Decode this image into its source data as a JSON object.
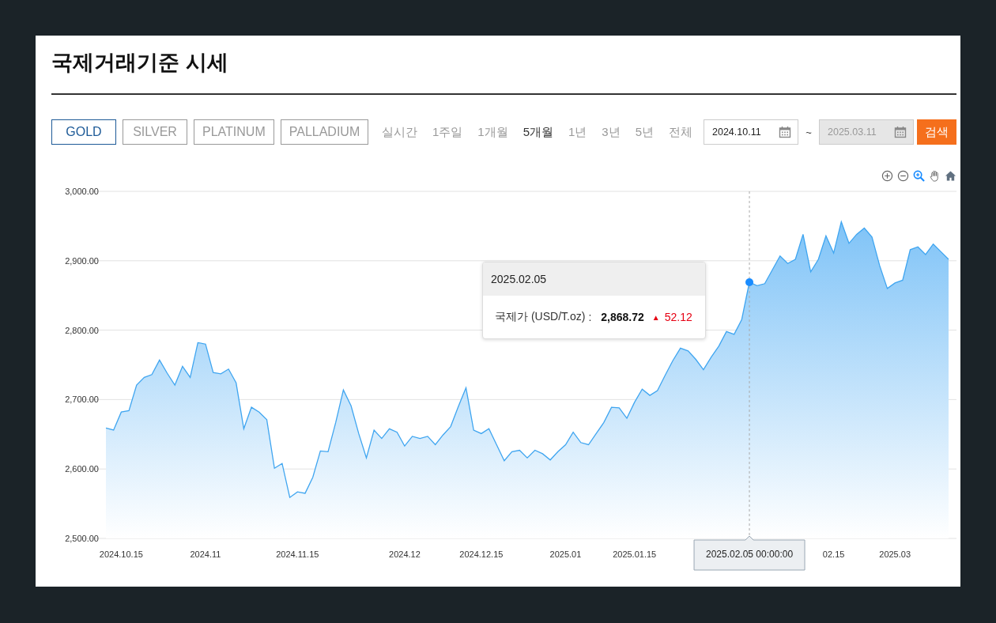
{
  "title": "국제거래기준 시세",
  "metals": [
    {
      "label": "GOLD",
      "selected": true
    },
    {
      "label": "SILVER",
      "selected": false
    },
    {
      "label": "PLATINUM",
      "selected": false
    },
    {
      "label": "PALLADIUM",
      "selected": false
    }
  ],
  "periods": [
    {
      "label": "실시간",
      "selected": false
    },
    {
      "label": "1주일",
      "selected": false
    },
    {
      "label": "1개월",
      "selected": false
    },
    {
      "label": "5개월",
      "selected": true
    },
    {
      "label": "1년",
      "selected": false
    },
    {
      "label": "3년",
      "selected": false
    },
    {
      "label": "5년",
      "selected": false
    },
    {
      "label": "전체",
      "selected": false
    }
  ],
  "date_range": {
    "start": "2024.10.11",
    "separator": "~",
    "end": "2025.03.11",
    "end_disabled": true
  },
  "search_button": "검색",
  "chart_tooltip": {
    "date": "2025.02.05",
    "separator": ":",
    "value": "2,868.72",
    "arrow": "▲",
    "change": "52.12"
  },
  "chart_data": {
    "type": "area",
    "grid": true,
    "ylim": [
      2500,
      3000
    ],
    "yticks": [
      {
        "value": 2500,
        "label": "2,500.00"
      },
      {
        "value": 2600,
        "label": "2,600.00"
      },
      {
        "value": 2700,
        "label": "2,700.00"
      },
      {
        "value": 2800,
        "label": "2,800.00"
      },
      {
        "value": 2900,
        "label": "2,900.00"
      },
      {
        "value": 3000,
        "label": "3,000.00"
      }
    ],
    "categories": [
      null,
      null,
      "2024.10.15",
      null,
      null,
      null,
      null,
      null,
      null,
      null,
      null,
      null,
      null,
      "2024.11",
      null,
      null,
      null,
      null,
      null,
      null,
      null,
      null,
      null,
      null,
      null,
      "2024.11.15",
      null,
      null,
      null,
      null,
      null,
      null,
      null,
      null,
      null,
      null,
      null,
      null,
      null,
      "2024.12",
      null,
      null,
      null,
      null,
      null,
      null,
      null,
      null,
      null,
      "2024.12.15",
      null,
      null,
      null,
      null,
      null,
      null,
      null,
      null,
      null,
      null,
      "2025.01",
      null,
      null,
      null,
      null,
      null,
      null,
      null,
      null,
      "2025.01.15",
      null,
      null,
      null,
      null,
      null,
      null,
      null,
      null,
      null,
      null,
      null,
      null,
      null,
      null,
      "2025.02.05 00:00:00",
      null,
      null,
      null,
      null,
      null,
      null,
      null,
      null,
      null,
      null,
      "02.15",
      null,
      null,
      null,
      null,
      null,
      null,
      null,
      "2025.03",
      null,
      null,
      null,
      null,
      null,
      null,
      null
    ],
    "series": [
      {
        "name": "국제가 (USD/T.oz)",
        "color": "#3fa5f0",
        "values": [
          2659,
          2656,
          2682,
          2684,
          2721,
          2732,
          2736,
          2757,
          2738,
          2721,
          2748,
          2732,
          2782,
          2780,
          2739,
          2737,
          2744,
          2724,
          2658,
          2689,
          2682,
          2671,
          2601,
          2608,
          2559,
          2567,
          2565,
          2588,
          2626,
          2625,
          2667,
          2714,
          2691,
          2651,
          2616,
          2656,
          2644,
          2658,
          2653,
          2633,
          2647,
          2644,
          2647,
          2635,
          2649,
          2661,
          2690,
          2717,
          2656,
          2651,
          2658,
          2635,
          2612,
          2625,
          2627,
          2616,
          2627,
          2622,
          2613,
          2625,
          2635,
          2653,
          2638,
          2635,
          2651,
          2667,
          2689,
          2688,
          2673,
          2696,
          2715,
          2706,
          2713,
          2735,
          2756,
          2774,
          2770,
          2758,
          2743,
          2761,
          2777,
          2798,
          2794,
          2815,
          2869,
          2864,
          2867,
          2887,
          2907,
          2896,
          2902,
          2938,
          2884,
          2902,
          2936,
          2911,
          2956,
          2925,
          2938,
          2947,
          2934,
          2893,
          2860,
          2868,
          2872,
          2916,
          2920,
          2909,
          2924,
          2913,
          2902
        ]
      }
    ],
    "annotations": [
      {
        "x": "2025.02.05 00:00:00"
      }
    ]
  }
}
